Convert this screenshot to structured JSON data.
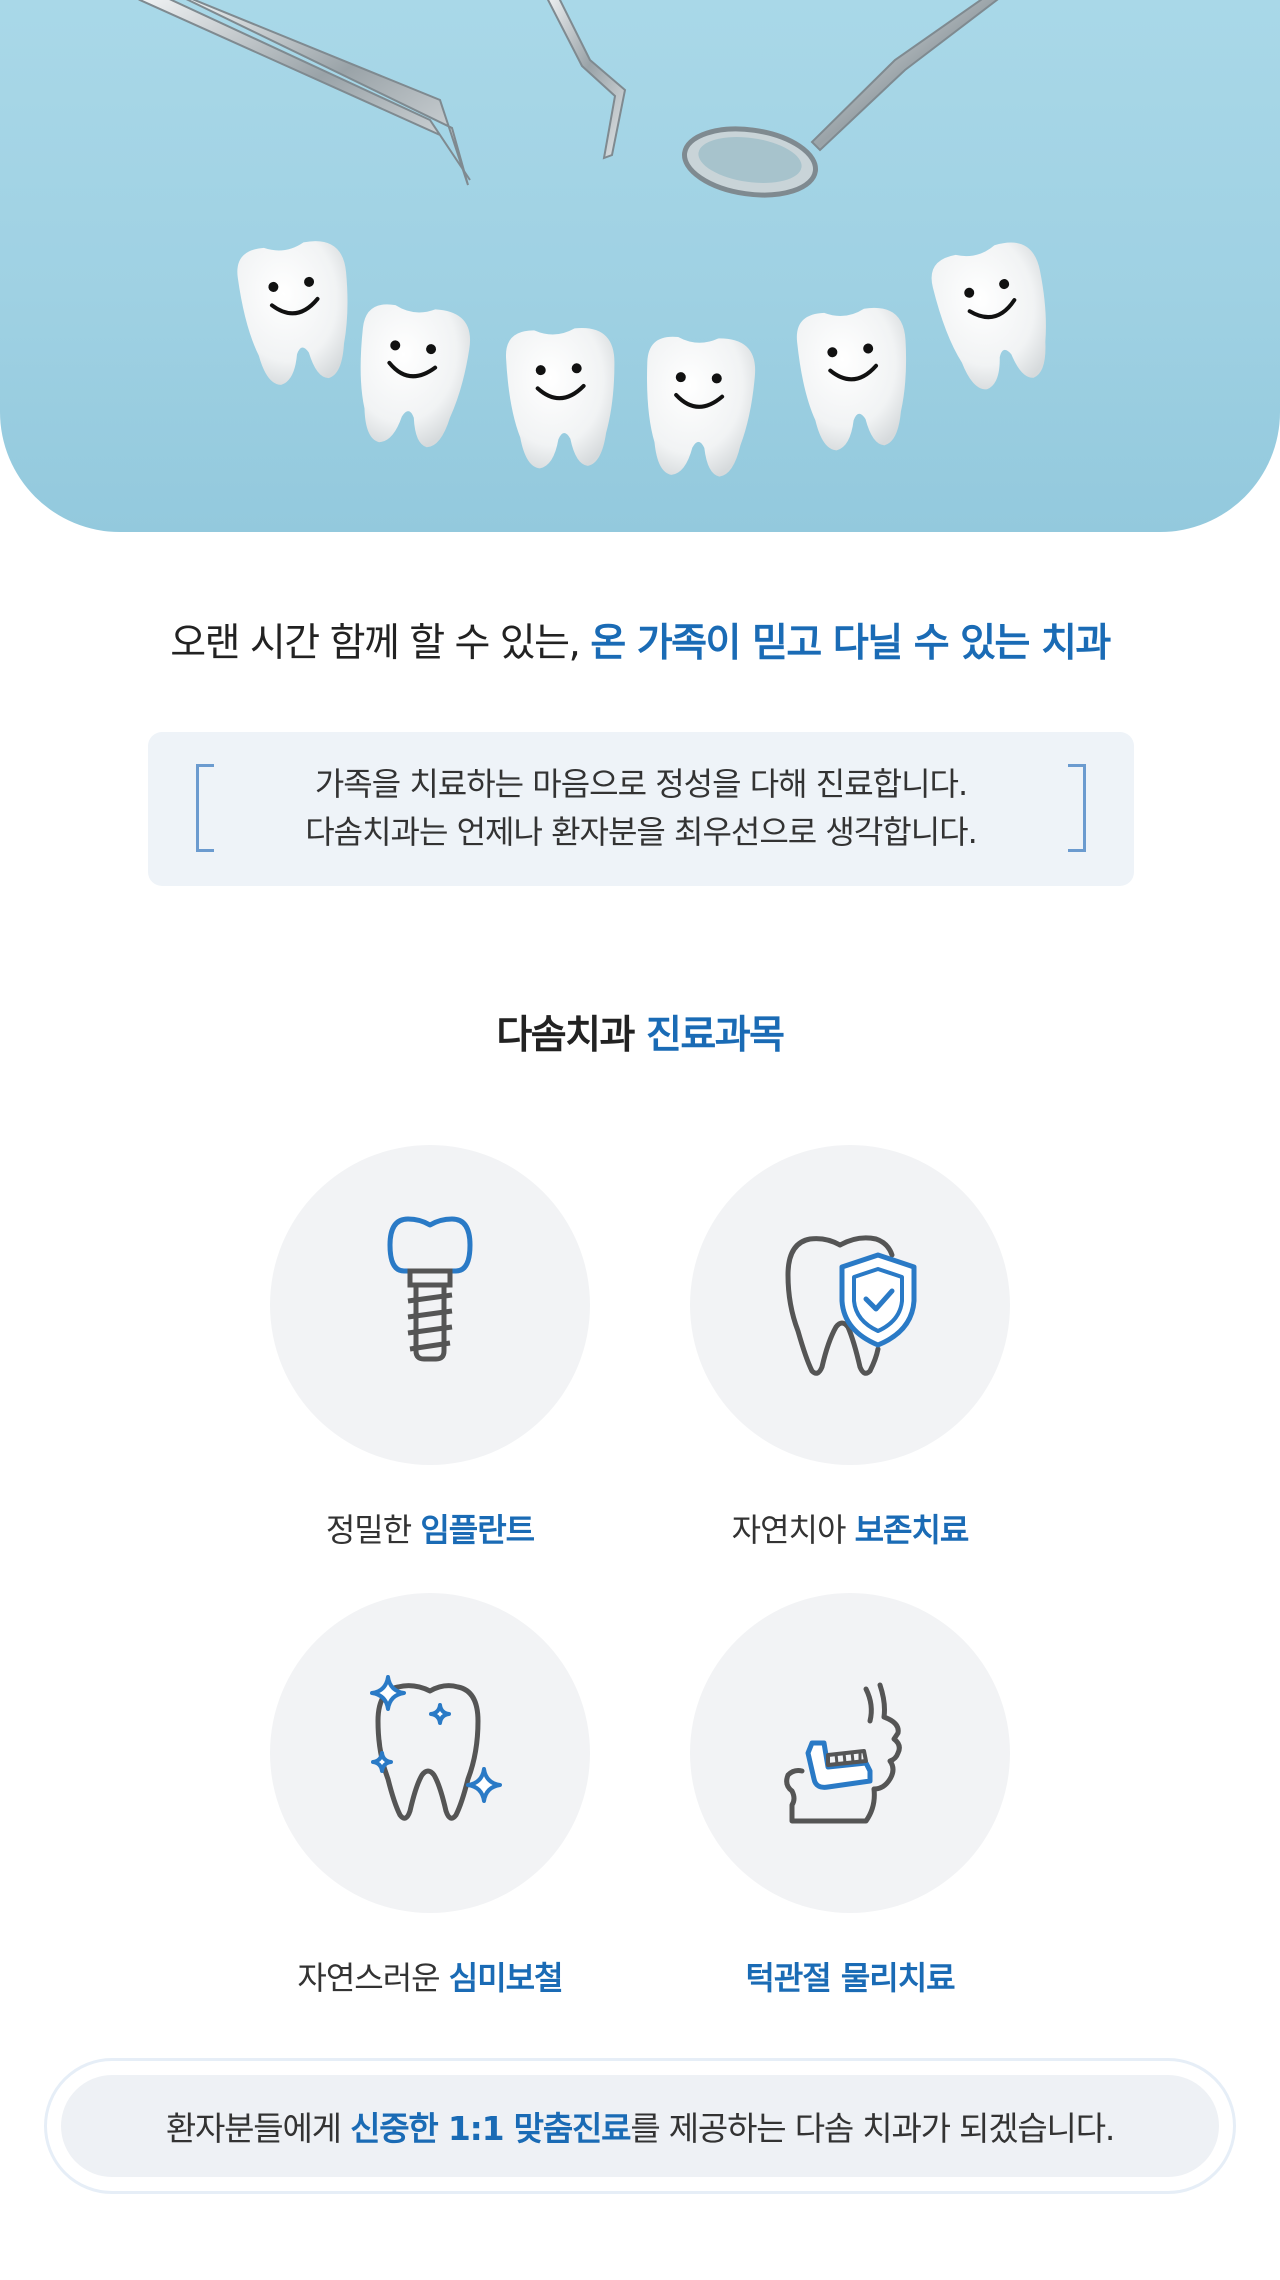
{
  "hero": {
    "image_icon": "smiling-teeth-with-dental-tools-photo"
  },
  "headline": {
    "lead": "오랜 시간 함께 할 수 있는,",
    "highlight": "온 가족이  믿고 다닐 수 있는 치과"
  },
  "quote": {
    "line1": "가족을 치료하는 마음으로 정성을 다해 진료합니다.",
    "line2": "다솜치과는 언제나 환자분을 최우선으로 생각합니다."
  },
  "services_section": {
    "title_lead": "다솜치과",
    "title_highlight": "진료과목"
  },
  "services": [
    {
      "icon": "dental-implant-icon",
      "label_lead": "정밀한",
      "label_highlight": "임플란트"
    },
    {
      "icon": "tooth-shield-icon",
      "label_lead": "자연치아",
      "label_highlight": "보존치료"
    },
    {
      "icon": "sparkling-tooth-icon",
      "label_lead": "자연스러운",
      "label_highlight": "심미보철"
    },
    {
      "icon": "jaw-joint-icon",
      "label_lead": "",
      "label_highlight": "턱관절 물리치료"
    }
  ],
  "closing": {
    "lead": "환자분들에게",
    "highlight": "신중한 1:1 맞춤진료",
    "tail": "를 제공하는 다솜 치과가 되겠습니다."
  },
  "colors": {
    "accent": "#1a6bb5",
    "hero_bg": "#9fd1e3",
    "icon_blue": "#2a7ac6",
    "icon_gray": "#555555",
    "circle_bg": "#f2f3f5",
    "quote_bg": "#eef3f8"
  }
}
